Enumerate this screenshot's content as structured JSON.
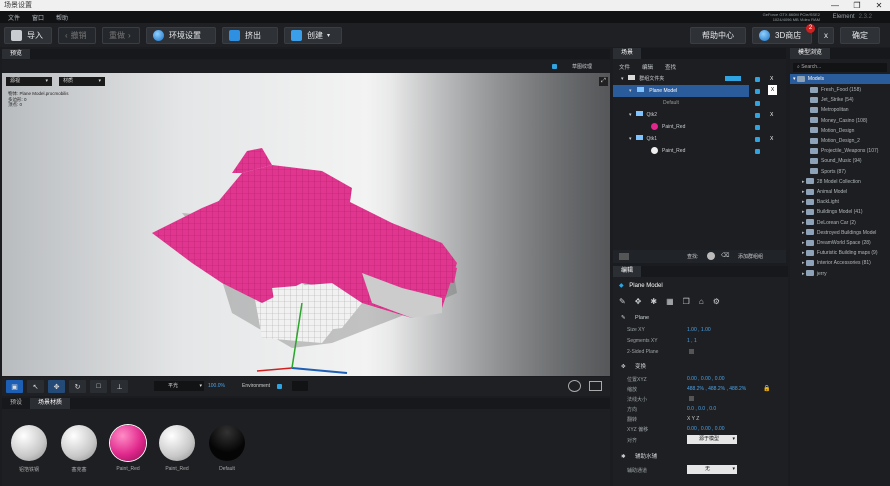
{
  "window": {
    "title": "场景设置",
    "controls": [
      "—",
      "❐",
      "✕"
    ]
  },
  "menu": [
    "文件",
    "窗口",
    "帮助"
  ],
  "gpu_info": [
    "GeForce GTX 860M PCIe/SSE2",
    "1024/4096 MB Video RAM"
  ],
  "element": {
    "name": "Element",
    "version": "2.3.2"
  },
  "toolbar": {
    "import": "导入",
    "undo": "撤销",
    "redo": "重做",
    "env": "环境设置",
    "extrude": "挤出",
    "create": "创建",
    "help": "帮助中心",
    "shop": "3D商店",
    "shop_badge": "2",
    "close": "x",
    "ok": "确定"
  },
  "preview": {
    "tab": "预览",
    "check_label": "草图纹理",
    "btn_left": "源视",
    "btn_right": "材质",
    "info": [
      {
        "k": "物体:",
        "v": "Plane Model.procmobilis"
      },
      {
        "k": "多边形:",
        "v": "0"
      },
      {
        "k": "顶点:",
        "v": "0"
      }
    ]
  },
  "viewbar": {
    "shading": "平光",
    "zoom": "100.0%",
    "env_label": "Environment"
  },
  "materials": {
    "tabs": [
      "预设",
      "场景材质"
    ],
    "items": [
      {
        "label": "铝箔铁钢",
        "color": "white"
      },
      {
        "label": "塞克塞",
        "color": "white"
      },
      {
        "label": "Paint_Red",
        "color": "pink"
      },
      {
        "label": "Paint_Red",
        "color": "white"
      },
      {
        "label": "Default",
        "color": "black"
      }
    ]
  },
  "scene": {
    "tab": "场景",
    "menu": [
      "文件",
      "编辑",
      "查找"
    ],
    "rows": [
      {
        "label": "群组文件夹",
        "indent": 0,
        "top": true
      },
      {
        "label": "Plane Model",
        "indent": 1,
        "selected": true
      },
      {
        "label": "Default",
        "indent": 2
      },
      {
        "label": "Qtk2",
        "indent": 1
      },
      {
        "label": "Paint_Red",
        "indent": 2,
        "swatch": "pink"
      },
      {
        "label": "Qtk1",
        "indent": 1
      },
      {
        "label": "Paint_Red",
        "indent": 2,
        "swatch": "white"
      }
    ],
    "footer": {
      "search": "查找:",
      "add": "添加群组组"
    }
  },
  "props": {
    "tab": "编辑",
    "model": "Plane Model",
    "sections": {
      "plane": "Plane",
      "transform": "变换",
      "aux": "辅助水辅"
    },
    "plane_rows": [
      {
        "k": "Size XY",
        "v": "1.00 ,  1.00"
      },
      {
        "k": "Segments XY",
        "v": "1 ,  1"
      },
      {
        "k": "2-Sided Plane",
        "v": ""
      }
    ],
    "transform_rows": [
      {
        "k": "位置XYZ",
        "v": "0.00 ,  0.00 ,  0.00"
      },
      {
        "k": "缩放",
        "v": "488.2% ,  488.2% ,  488.2%"
      },
      {
        "k": "法线大小",
        "v": ""
      },
      {
        "k": "方向",
        "v": "0.0 ,  0.0 ,  0.0"
      },
      {
        "k": "翻转",
        "v": "X    Y    Z"
      },
      {
        "k": "XYZ 偏移",
        "v": "0.00 ,  0.00 ,  0.00"
      },
      {
        "k": "对齐",
        "v": "源于模型"
      }
    ],
    "aux_rows": [
      {
        "k": "辅助通道",
        "v": "无"
      }
    ]
  },
  "library": {
    "tab": "模型浏览",
    "search_placeholder": "Search...",
    "root": "Models",
    "items": [
      "Fresh_Food (158)",
      "Jet_Strike (54)",
      "Metropolitan",
      "Money_Casino (108)",
      "Motion_Design",
      "Motion_Design_2",
      "Projectile_Weapons (107)",
      "Sound_Music (94)",
      "Sports (87)",
      "28 Model Collection",
      "Animal Model",
      "BackLight",
      "Buildings Model (41)",
      "DeLorean Car (2)",
      "Destroyed Buildings Model",
      "DreamWorld Space (28)",
      "Futuristic Building maps (9)",
      "Interior Accessories (81)",
      "jerry"
    ]
  }
}
